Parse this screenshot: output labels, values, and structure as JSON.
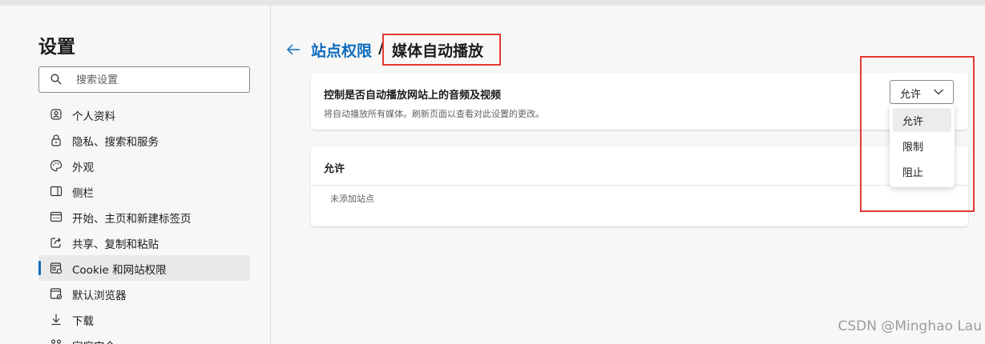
{
  "sidebar": {
    "title": "设置",
    "search_placeholder": "搜索设置",
    "items": [
      {
        "label": "个人资料",
        "icon": "profile-icon"
      },
      {
        "label": "隐私、搜索和服务",
        "icon": "lock-icon"
      },
      {
        "label": "外观",
        "icon": "palette-icon"
      },
      {
        "label": "侧栏",
        "icon": "sidebar-icon"
      },
      {
        "label": "开始、主页和新建标签页",
        "icon": "home-tab-icon"
      },
      {
        "label": "共享、复制和粘贴",
        "icon": "share-icon"
      },
      {
        "label": "Cookie 和网站权限",
        "icon": "site-permissions-icon",
        "active": true
      },
      {
        "label": "默认浏览器",
        "icon": "browser-icon"
      },
      {
        "label": "下载",
        "icon": "download-icon"
      },
      {
        "label": "家庭安全",
        "icon": "family-icon"
      }
    ]
  },
  "header": {
    "breadcrumb_parent": "站点权限",
    "separator": "/",
    "breadcrumb_current": "媒体自动播放"
  },
  "autoplay_card": {
    "title": "控制是否自动播放网站上的音频及视频",
    "description": "将自动播放所有媒体。刷新页面以查看对此设置的更改。",
    "selected_value": "允许"
  },
  "dropdown": {
    "options": [
      "允许",
      "限制",
      "阻止"
    ],
    "selected_index": 0
  },
  "allow_card": {
    "title": "允许",
    "empty_text": "未添加站点"
  },
  "watermark": "CSDN @Minghao Lau",
  "colors": {
    "accent": "#0f6cbd",
    "highlight_box": "#e53935"
  }
}
